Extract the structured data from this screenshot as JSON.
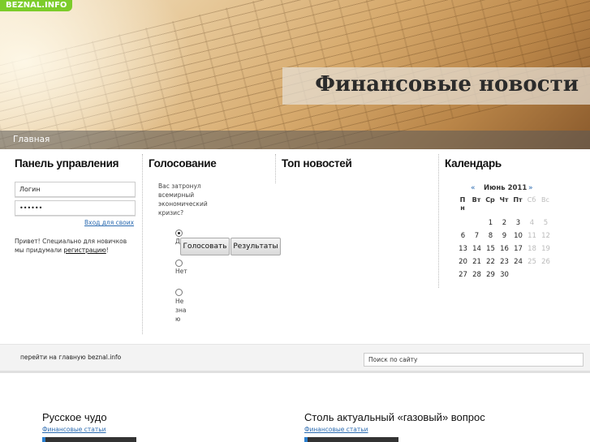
{
  "site": {
    "badge": "BEZNAL.INFO",
    "title": "Финансовые новости"
  },
  "nav": {
    "items": [
      "Главная"
    ]
  },
  "control_panel": {
    "title": "Панель управления",
    "login_value": "Логин",
    "password_value": "••••••",
    "login_link": "Вход для своих",
    "greeting_text": "Привет! Специально для новичков мы придумали ",
    "register_link": "регистрацию",
    "greeting_end": "!"
  },
  "poll": {
    "title": "Голосование",
    "question": "Вас затронул всемирный экономический кризис?",
    "options": [
      "Да",
      "Нет",
      "Не знаю"
    ],
    "selected": 0,
    "vote_button": "Голосовать",
    "results_button": "Результаты"
  },
  "top_news": {
    "title": "Топ новостей"
  },
  "calendar": {
    "title": "Календарь",
    "prev": "«",
    "next": "»",
    "month": "Июнь 2011",
    "weekdays": [
      "Пн",
      "Вт",
      "Ср",
      "Чт",
      "Пт",
      "Сб",
      "Вс"
    ],
    "weeks": [
      [
        "",
        "",
        "1",
        "2",
        "3",
        "4",
        "5"
      ],
      [
        "6",
        "7",
        "8",
        "9",
        "10",
        "11",
        "12"
      ],
      [
        "13",
        "14",
        "15",
        "16",
        "17",
        "18",
        "19"
      ],
      [
        "20",
        "21",
        "22",
        "23",
        "24",
        "25",
        "26"
      ],
      [
        "27",
        "28",
        "29",
        "30",
        "",
        "",
        ""
      ]
    ]
  },
  "footer": {
    "home_link": "перейти на главную beznal.info",
    "search_placeholder": "Поиск по сайту"
  },
  "articles": [
    {
      "title": "Русское чудо",
      "category": "Финансовые статьи"
    },
    {
      "title": "Столь актуальный «газовый» вопрос",
      "category": "Финансовые статьи"
    }
  ]
}
